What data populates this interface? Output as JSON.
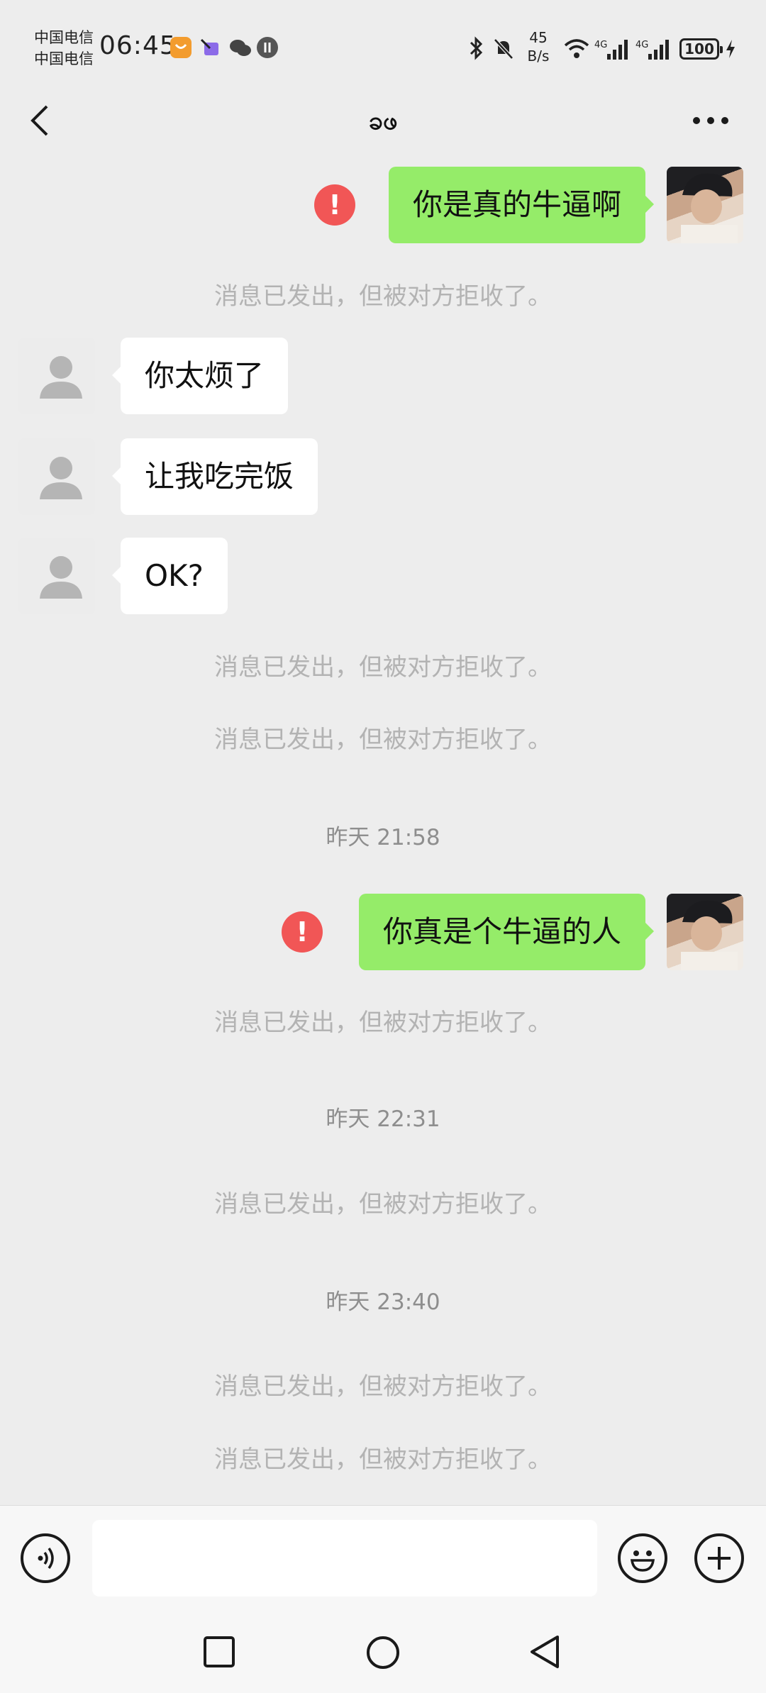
{
  "status_bar": {
    "carrier_1": "中国电信",
    "carrier_2": "中国电信",
    "time": "06:45",
    "net_speed_value": "45",
    "net_speed_unit": "B/s",
    "signal_1_label": "4G",
    "signal_2_label": "4G",
    "battery": "100"
  },
  "header": {
    "title": "ခဖ"
  },
  "messages": [
    {
      "type": "sent",
      "text": "你是真的牛逼啊",
      "status": "!"
    },
    {
      "type": "system",
      "text": "消息已发出，但被对方拒收了。"
    },
    {
      "type": "received",
      "text": "你太烦了"
    },
    {
      "type": "received",
      "text": "让我吃完饭"
    },
    {
      "type": "received",
      "text": "OK?"
    },
    {
      "type": "system",
      "text": "消息已发出，但被对方拒收了。"
    },
    {
      "type": "system",
      "text": "消息已发出，但被对方拒收了。"
    },
    {
      "type": "time",
      "text": "昨天 21:58"
    },
    {
      "type": "sent",
      "text": "你真是个牛逼的人",
      "status": "!"
    },
    {
      "type": "system",
      "text": "消息已发出，但被对方拒收了。"
    },
    {
      "type": "time",
      "text": "昨天 22:31"
    },
    {
      "type": "system",
      "text": "消息已发出，但被对方拒收了。"
    },
    {
      "type": "time",
      "text": "昨天 23:40"
    },
    {
      "type": "system",
      "text": "消息已发出，但被对方拒收了。"
    },
    {
      "type": "system",
      "text": "消息已发出，但被对方拒收了。"
    }
  ],
  "input_bar": {
    "value": "",
    "voice_icon": "voice-icon",
    "emoji_icon": "emoji-icon",
    "plus_icon": "plus-icon"
  },
  "colors": {
    "sent_bubble": "#95ec69",
    "received_bubble": "#ffffff",
    "error": "#f15656",
    "background": "#ededed"
  }
}
